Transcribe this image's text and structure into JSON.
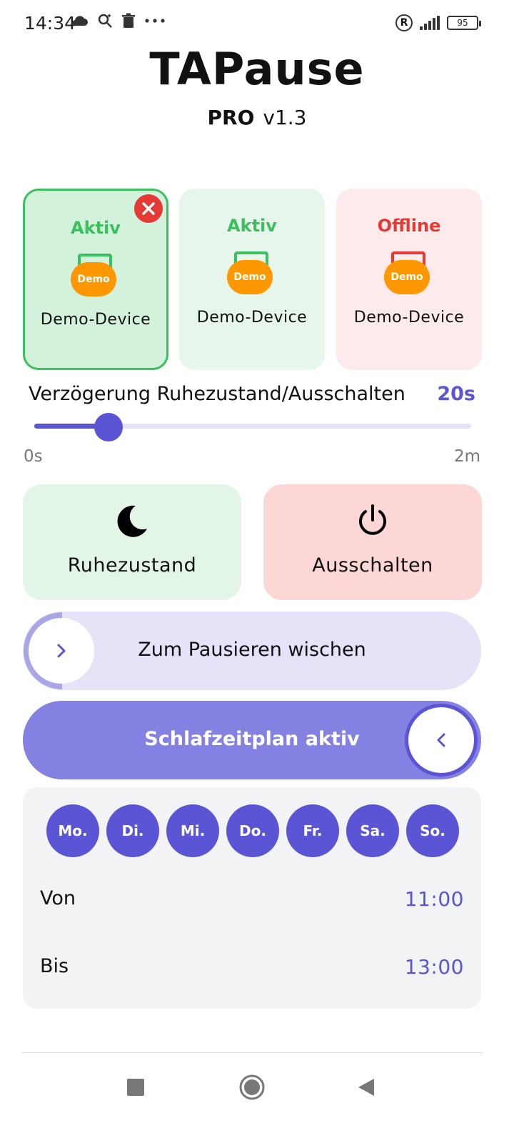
{
  "status_bar": {
    "time": "14:34",
    "left_icons": [
      "cloud-icon",
      "search-sparkle-icon",
      "trash-icon",
      "more-dots-icon"
    ],
    "battery": "95"
  },
  "header": {
    "title": "TAPause",
    "edition": "PRO",
    "version": "v1.3"
  },
  "devices": [
    {
      "status": "Aktiv",
      "badge": "Demo",
      "name": "Demo-Device",
      "status_color": "#3cbf5e",
      "bg": "#d3f2dc",
      "selected": true
    },
    {
      "status": "Aktiv",
      "badge": "Demo",
      "name": "Demo-Device",
      "status_color": "#3cbf5e",
      "bg": "#e6f6ea",
      "selected": false
    },
    {
      "status": "Offline",
      "badge": "Demo",
      "name": "Demo-Device",
      "status_color": "#e53935",
      "bg": "#fdeaea",
      "selected": false
    }
  ],
  "delay": {
    "label": "Verzögerung Ruhezustand/Ausschalten",
    "value": "20s",
    "min_label": "0s",
    "max_label": "2m",
    "fraction": 0.17
  },
  "actions": {
    "sleep_label": "Ruhezustand",
    "shutdown_label": "Ausschalten"
  },
  "swipe": {
    "pause_label": "Zum Pausieren wischen",
    "schedule_label": "Schlafzeitplan aktiv"
  },
  "schedule": {
    "days": [
      "Mo.",
      "Di.",
      "Mi.",
      "Do.",
      "Fr.",
      "Sa.",
      "So."
    ],
    "from_label": "Von",
    "from_value": "11:00",
    "to_label": "Bis",
    "to_value": "13:00"
  },
  "colors": {
    "accent": "#5b55d6",
    "active": "#3cbf5e",
    "offline": "#e53935",
    "badge": "#ff9800"
  }
}
